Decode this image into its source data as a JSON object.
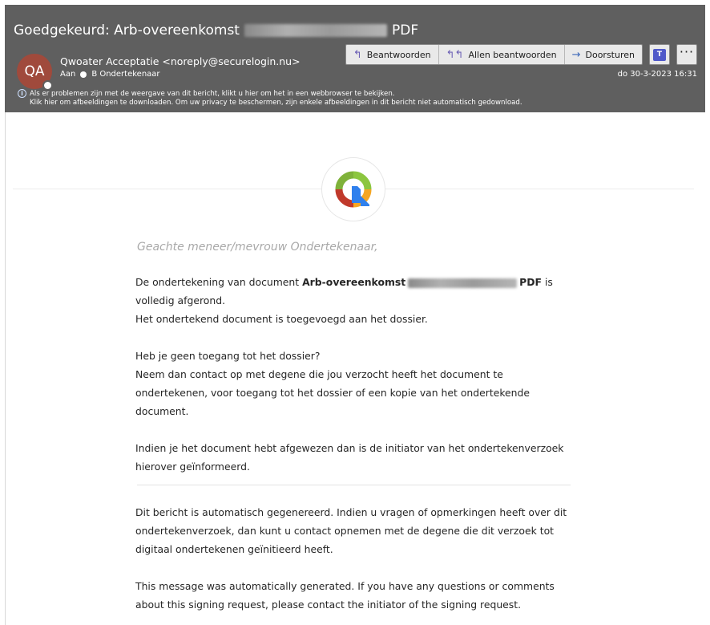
{
  "header": {
    "subject_prefix": "Goedgekeurd: Arb-overeenkomst",
    "subject_suffix": "PDF",
    "avatar_initials": "QA",
    "sender": "Qwoater Acceptatie <noreply@securelogin.nu>",
    "to_label": "Aan",
    "recipient": "B Ondertekenaar",
    "date": "do 30-3-2023 16:31",
    "info_line1": "Als er problemen zijn met de weergave van dit bericht, klikt u hier om het in een webbrowser te bekijken.",
    "info_line2": "Klik hier om afbeeldingen te downloaden. Om uw privacy te beschermen, zijn enkele afbeeldingen in dit bericht niet automatisch gedownload.",
    "actions": {
      "reply": "Beantwoorden",
      "reply_all": "Allen beantwoorden",
      "forward": "Doorsturen"
    },
    "teams_label": "T",
    "more_label": "···"
  },
  "body": {
    "greeting": "Geachte meneer/mevrouw Ondertekenaar,",
    "p1_prefix": "De ondertekening van document ",
    "p1_doc_start": "Arb-overeenkomst",
    "p1_doc_end": "PDF",
    "p1_suffix": " is volledig afgerond.",
    "p1_line2": "Het ondertekend document is toegevoegd aan het dossier.",
    "p2_line1": "Heb je geen toegang tot het dossier?",
    "p2_line2": "Neem dan contact op met degene die jou verzocht heeft het document te ondertekenen, voor toegang tot het dossier of een kopie van het ondertekende document.",
    "p3": "Indien je het document hebt afgewezen dan is de initiator van het ondertekenverzoek hierover geïnformeerd.",
    "p4": "Dit bericht is automatisch gegenereerd. Indien u vragen of opmerkingen heeft over dit ondertekenverzoek, dan kunt u contact opnemen met de degene die dit verzoek tot digitaal ondertekenen geïnitieerd heeft.",
    "p5": "This message was automatically generated. If you have any questions or comments about this signing request, please contact the initiator of the signing request."
  },
  "colors": {
    "header_bg": "#5f5f5f",
    "avatar_bg": "#a04a3c",
    "logo_green": "#8cc63f",
    "logo_orange": "#f5a623",
    "logo_red": "#c0392b",
    "logo_blue": "#2f80ed"
  }
}
